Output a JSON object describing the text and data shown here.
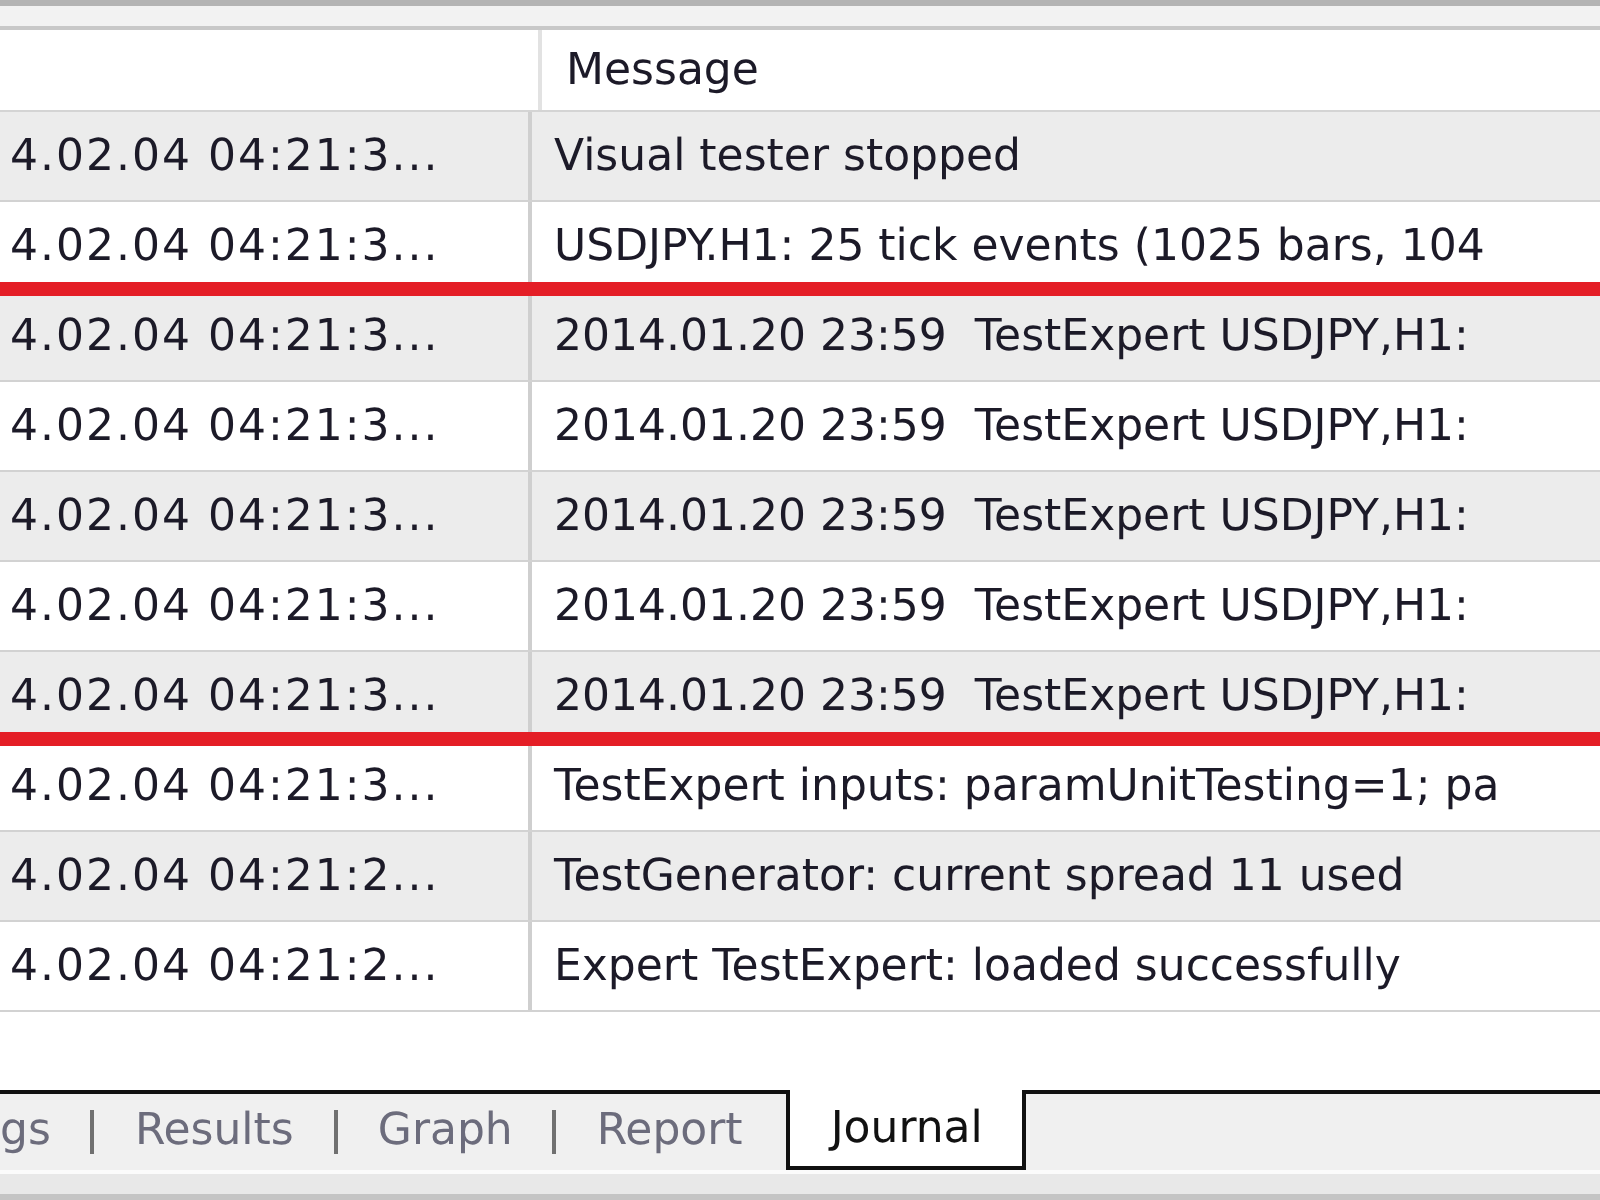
{
  "table": {
    "message_header": "Message",
    "rows": [
      {
        "column_1": "4.02.04 04:21:3...",
        "message": "Visual tester stopped",
        "underlined": false
      },
      {
        "column_1": "4.02.04 04:21:3...",
        "message": "USDJPY.H1: 25 tick events (1025 bars, 104",
        "underlined": true
      },
      {
        "column_1": "4.02.04 04:21:3...",
        "message": "2014.01.20 23:59  TestExpert USDJPY,H1:",
        "underlined": false
      },
      {
        "column_1": "4.02.04 04:21:3...",
        "message": "2014.01.20 23:59  TestExpert USDJPY,H1:",
        "underlined": false
      },
      {
        "column_1": "4.02.04 04:21:3...",
        "message": "2014.01.20 23:59  TestExpert USDJPY,H1:",
        "underlined": false
      },
      {
        "column_1": "4.02.04 04:21:3...",
        "message": "2014.01.20 23:59  TestExpert USDJPY,H1:",
        "underlined": false
      },
      {
        "column_1": "4.02.04 04:21:3...",
        "message": "2014.01.20 23:59  TestExpert USDJPY,H1:",
        "underlined": true
      },
      {
        "column_1": "4.02.04 04:21:3...",
        "message": "TestExpert inputs: paramUnitTesting=1; pa",
        "underlined": false
      },
      {
        "column_1": "4.02.04 04:21:2...",
        "message": "TestGenerator: current spread 11 used",
        "underlined": false
      },
      {
        "column_1": "4.02.04 04:21:2...",
        "message": "Expert TestExpert: loaded successfully",
        "underlined": false
      }
    ]
  },
  "tabs": [
    {
      "label": "gs",
      "selected": false
    },
    {
      "label": "Results",
      "selected": false
    },
    {
      "label": "Graph",
      "selected": false
    },
    {
      "label": "Report",
      "selected": false
    },
    {
      "label": "Journal",
      "selected": true
    }
  ]
}
